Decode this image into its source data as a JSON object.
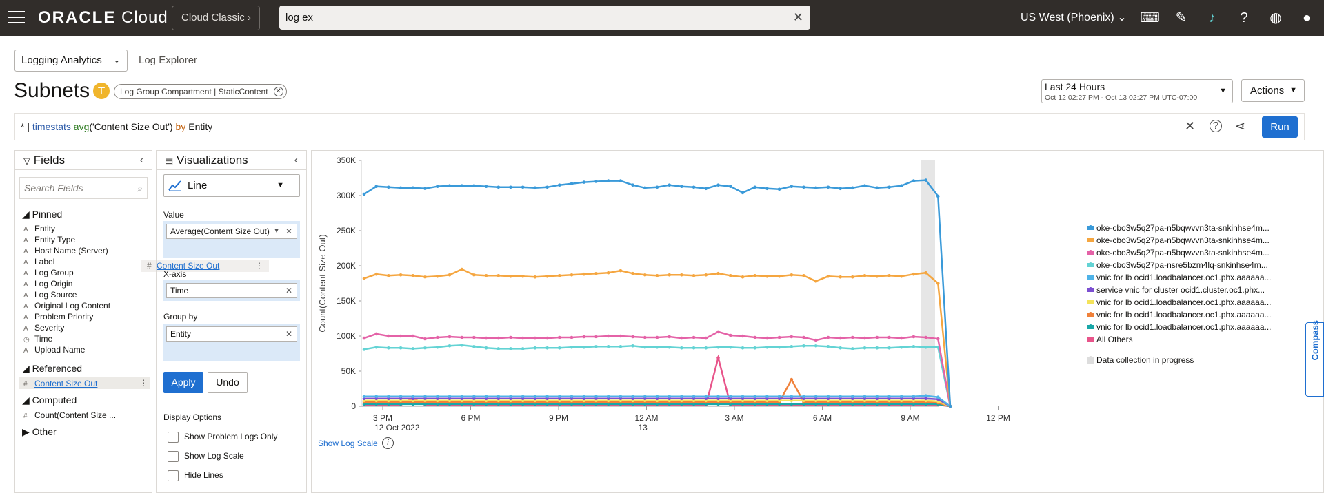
{
  "header": {
    "logo_brand": "ORACLE",
    "logo_product": "Cloud",
    "classic_label": "Cloud Classic",
    "search_value": "log ex",
    "region": "US West (Phoenix)"
  },
  "breadcrumb": {
    "app": "Logging Analytics",
    "page": "Log Explorer"
  },
  "title": "Subnets",
  "filter_chip": "Log Group Compartment | StaticContent",
  "time_range": {
    "label": "Last 24 Hours",
    "detail": "Oct 12 02:27 PM - Oct 13 02:27 PM UTC-07:00"
  },
  "actions_label": "Actions",
  "query": {
    "prefix": "* | ",
    "cmd": "timestats",
    "fn": "avg",
    "arg": "('Content Size Out')",
    "by": "by",
    "group": "Entity"
  },
  "run_label": "Run",
  "fields": {
    "title": "Fields",
    "search_placeholder": "Search Fields",
    "pinned_label": "Pinned",
    "pinned": [
      "Entity",
      "Entity Type",
      "Host Name (Server)",
      "Label",
      "Log Group",
      "Log Origin",
      "Log Source",
      "Original Log Content",
      "Problem Priority",
      "Severity",
      "Time",
      "Upload Name"
    ],
    "referenced_label": "Referenced",
    "referenced": "Content Size Out",
    "computed_label": "Computed",
    "computed": "Count(Content Size ...",
    "other_label": "Other",
    "drag_ghost": "Content Size Out"
  },
  "viz": {
    "title": "Visualizations",
    "type": "Line",
    "value_label": "Value",
    "value_pill": "Average(Content Size Out)",
    "xaxis_label": "X-axis",
    "xaxis_pill": "Time",
    "groupby_label": "Group by",
    "groupby_pill": "Entity",
    "apply": "Apply",
    "undo": "Undo",
    "display_options": "Display Options",
    "opt1": "Show Problem Logs Only",
    "opt2": "Show Log Scale",
    "opt3": "Hide Lines"
  },
  "chart_data": {
    "type": "line",
    "ylabel": "Count(Content Size Out)",
    "ylim": [
      0,
      350000
    ],
    "y_ticks": [
      "0",
      "50K",
      "100K",
      "150K",
      "200K",
      "250K",
      "300K",
      "350K"
    ],
    "x_ticks": [
      {
        "label": "3 PM",
        "sub": "12 Oct 2022"
      },
      {
        "label": "6 PM",
        "sub": ""
      },
      {
        "label": "9 PM",
        "sub": ""
      },
      {
        "label": "12 AM",
        "sub": "13"
      },
      {
        "label": "3 AM",
        "sub": ""
      },
      {
        "label": "6 AM",
        "sub": ""
      },
      {
        "label": "9 AM",
        "sub": ""
      },
      {
        "label": "12 PM",
        "sub": ""
      }
    ],
    "series": [
      {
        "name": "oke-cbo3w5q27pa-n5bqwvvn3ta-snkinhse4m...",
        "color": "#3a9ad9",
        "values": [
          302000,
          313000,
          312000,
          311000,
          311000,
          310000,
          313000,
          314000,
          314000,
          314000,
          313000,
          312000,
          312000,
          312000,
          311000,
          312000,
          315000,
          317000,
          319000,
          320000,
          321000,
          321000,
          315000,
          311000,
          312000,
          315000,
          313000,
          312000,
          310000,
          315000,
          313000,
          304000,
          312000,
          310000,
          309000,
          313000,
          312000,
          311000,
          312000,
          310000,
          311000,
          314000,
          311000,
          312000,
          314000,
          321000,
          322000,
          299000,
          0
        ]
      },
      {
        "name": "oke-cbo3w5q27pa-n5bqwvvn3ta-snkinhse4m...",
        "color": "#f5a640",
        "values": [
          182000,
          188000,
          186000,
          187000,
          186000,
          184000,
          185000,
          187000,
          195000,
          187000,
          186000,
          186000,
          185000,
          185000,
          184000,
          185000,
          186000,
          187000,
          188000,
          189000,
          190000,
          193000,
          189000,
          187000,
          186000,
          187000,
          187000,
          186000,
          187000,
          189000,
          186000,
          184000,
          186000,
          185000,
          185000,
          187000,
          186000,
          178000,
          185000,
          184000,
          184000,
          186000,
          185000,
          186000,
          185000,
          188000,
          190000,
          175000,
          0
        ]
      },
      {
        "name": "oke-cbo3w5q27pa-n5bqwvvn3ta-snkinhse4m...",
        "color": "#e462a7",
        "values": [
          97000,
          103000,
          100000,
          100000,
          100000,
          96000,
          98000,
          99000,
          98000,
          98000,
          97000,
          97000,
          98000,
          97000,
          97000,
          97000,
          98000,
          98000,
          99000,
          99000,
          100000,
          100000,
          99000,
          98000,
          98000,
          99000,
          97000,
          98000,
          97000,
          106000,
          101000,
          100000,
          98000,
          97000,
          98000,
          99000,
          98000,
          94000,
          98000,
          97000,
          98000,
          97000,
          98000,
          98000,
          97000,
          99000,
          98000,
          96000,
          0
        ]
      },
      {
        "name": "oke-cbo3w5q27pa-nsre5bzm4lq-snkinhse4m...",
        "color": "#63d3d4",
        "values": [
          81000,
          84000,
          83000,
          83000,
          82000,
          83000,
          84000,
          86000,
          87000,
          85000,
          83000,
          82000,
          82000,
          82000,
          83000,
          83000,
          83000,
          84000,
          84000,
          85000,
          85000,
          85000,
          86000,
          84000,
          84000,
          84000,
          83000,
          83000,
          83000,
          84000,
          84000,
          83000,
          83000,
          84000,
          84000,
          85000,
          86000,
          86000,
          85000,
          83000,
          82000,
          83000,
          83000,
          83000,
          84000,
          85000,
          84000,
          84000,
          0
        ]
      },
      {
        "name": "vnic for lb ocid1.loadbalancer.oc1.phx.aaaaaa...",
        "color": "#4fb3e8",
        "values": [
          14000,
          14000,
          14000,
          14000,
          14000,
          14000,
          14000,
          14000,
          14000,
          14000,
          14000,
          14000,
          14000,
          14000,
          14000,
          14000,
          14000,
          14000,
          14000,
          14000,
          14000,
          14000,
          14000,
          14000,
          14000,
          14000,
          14000,
          14000,
          14000,
          14000,
          14000,
          14000,
          14000,
          14000,
          14000,
          14000,
          14000,
          14000,
          14000,
          14000,
          14000,
          14000,
          14000,
          14000,
          14000,
          14000,
          15000,
          13000,
          0
        ]
      },
      {
        "name": "service vnic for cluster ocid1.cluster.oc1.phx...",
        "color": "#7c4fd1",
        "values": [
          11000,
          11000,
          11000,
          11000,
          11000,
          11000,
          11000,
          11000,
          11000,
          11000,
          11000,
          11000,
          11000,
          11000,
          11000,
          11000,
          11000,
          11000,
          11000,
          11000,
          11000,
          11000,
          11000,
          11000,
          11000,
          11000,
          11000,
          11000,
          11000,
          11000,
          11000,
          11000,
          11000,
          11000,
          11000,
          11000,
          11000,
          11000,
          11000,
          11000,
          11000,
          11000,
          11000,
          11000,
          11000,
          11000,
          11000,
          10000,
          0
        ]
      },
      {
        "name": "vnic for lb ocid1.loadbalancer.oc1.phx.aaaaaa...",
        "color": "#f4e35a",
        "values": [
          8000,
          8000,
          8000,
          8000,
          8000,
          8000,
          8000,
          8000,
          8000,
          8000,
          8000,
          8000,
          8000,
          8000,
          8000,
          8000,
          8000,
          8000,
          8000,
          8000,
          8000,
          8000,
          8000,
          8000,
          8000,
          8000,
          8000,
          8000,
          8000,
          8000,
          8000,
          8000,
          8000,
          8000,
          8000,
          8000,
          8000,
          8000,
          8000,
          8000,
          8000,
          8000,
          8000,
          8000,
          8000,
          8000,
          8000,
          7000,
          0
        ]
      },
      {
        "name": "vnic for lb ocid1.loadbalancer.oc1.phx.aaaaaa...",
        "color": "#f0813a",
        "values": [
          6000,
          6000,
          6000,
          6000,
          6000,
          6000,
          6000,
          6000,
          6000,
          6000,
          6000,
          6000,
          6000,
          6000,
          6000,
          6000,
          6000,
          6000,
          6000,
          6000,
          6000,
          6000,
          6000,
          6000,
          6000,
          6000,
          6000,
          6000,
          6000,
          6000,
          6000,
          6000,
          6000,
          6000,
          6000,
          38000,
          6000,
          6000,
          6000,
          6000,
          6000,
          6000,
          6000,
          6000,
          6000,
          6000,
          6000,
          5000,
          0
        ]
      },
      {
        "name": "vnic for lb ocid1.loadbalancer.oc1.phx.aaaaaa...",
        "color": "#19a7a8",
        "values": [
          3000,
          3000,
          3000,
          3000,
          3000,
          3000,
          3000,
          3000,
          3000,
          3000,
          3000,
          3000,
          3000,
          3000,
          3000,
          3000,
          3000,
          3000,
          3000,
          3000,
          3000,
          3000,
          3000,
          3000,
          3000,
          3000,
          3000,
          3000,
          3000,
          3000,
          3000,
          3000,
          3000,
          3000,
          3000,
          3000,
          3000,
          3000,
          3000,
          3000,
          3000,
          3000,
          3000,
          3000,
          3000,
          3000,
          3000,
          3000,
          0
        ]
      },
      {
        "name": "All Others",
        "color": "#e8548a",
        "values": [
          2000,
          2000,
          2000,
          2000,
          12000,
          2000,
          2000,
          2000,
          2000,
          2000,
          2000,
          2000,
          2000,
          2000,
          2000,
          2000,
          2000,
          2000,
          2000,
          2000,
          2000,
          2000,
          2000,
          2000,
          2000,
          2000,
          2000,
          2000,
          2000,
          69000,
          2000,
          2000,
          2000,
          2000,
          2000,
          2000,
          2000,
          2000,
          2000,
          2000,
          2000,
          2000,
          2000,
          2000,
          2000,
          2000,
          2000,
          2000,
          0
        ]
      }
    ],
    "in_progress_label": "Data collection in progress"
  },
  "show_log_scale": "Show Log Scale",
  "compass_label": "Compass"
}
